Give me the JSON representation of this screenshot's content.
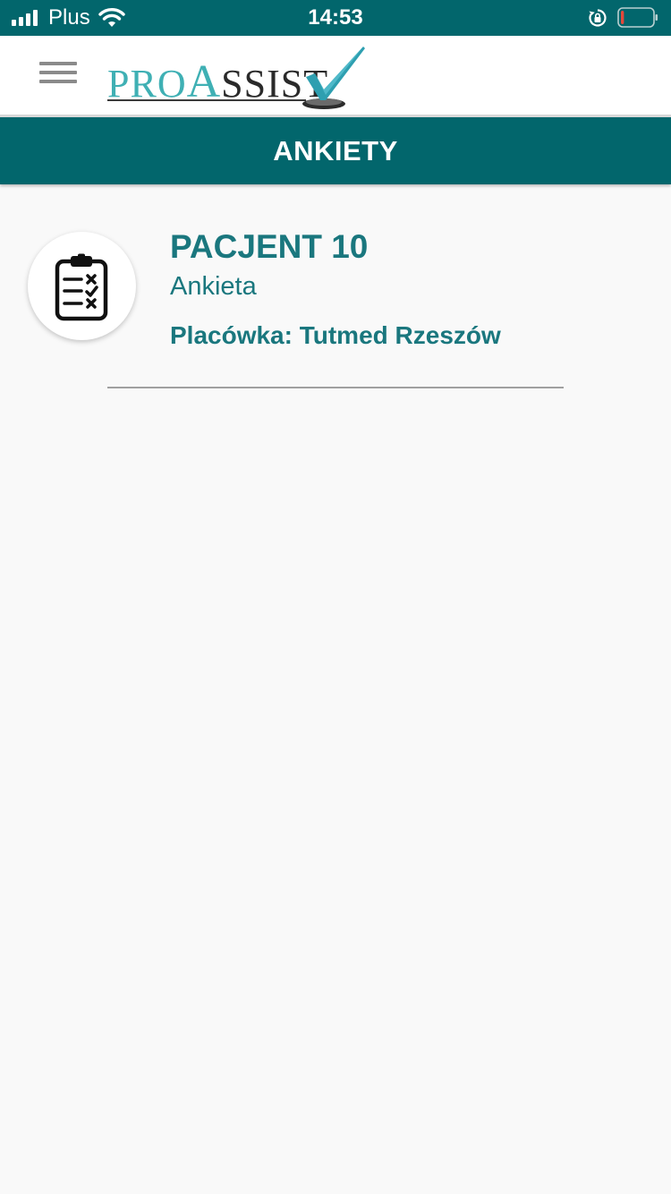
{
  "status_bar": {
    "carrier": "Plus",
    "time": "14:53",
    "icons": [
      "signal-icon",
      "wifi-icon",
      "rotation-lock-icon",
      "battery-icon"
    ],
    "battery_level_fraction": 0.1,
    "battery_color": "#e5483a"
  },
  "header": {
    "menu_icon": "hamburger-menu-icon",
    "logo": {
      "part1": "PRO",
      "part2": "A",
      "part3": "SSIST",
      "check_icon": "checkmark-icon"
    }
  },
  "page": {
    "title": "ANKIETY"
  },
  "surveys": [
    {
      "icon": "clipboard-checklist-icon",
      "patient": "PACJENT 10",
      "type": "Ankieta",
      "facility": "Placówka: Tutmed Rzeszów"
    }
  ],
  "colors": {
    "primary": "#02666c",
    "accent_text": "#1a777e",
    "logo_teal": "#3fb0b4",
    "background": "#f9f9f9"
  }
}
